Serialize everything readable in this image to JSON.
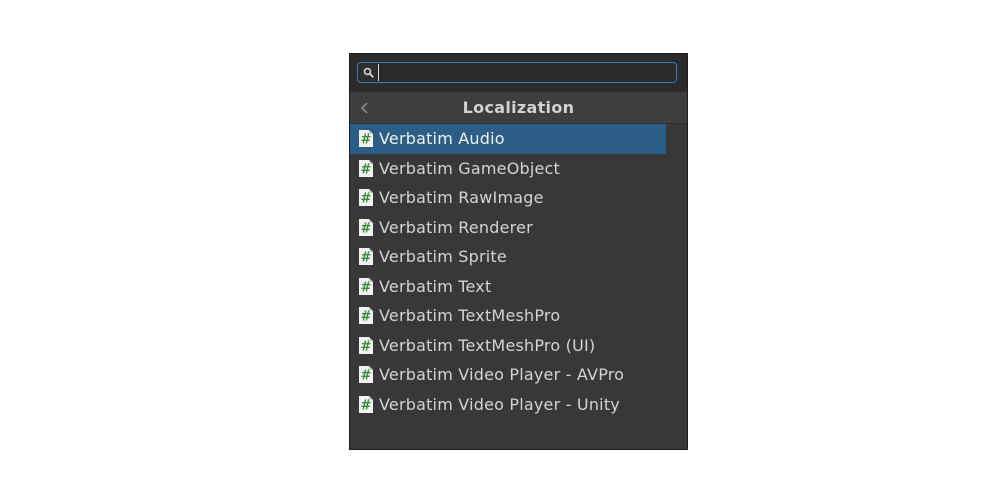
{
  "search": {
    "value": "",
    "placeholder": ""
  },
  "header": {
    "title": "Localization",
    "back_icon": "chevron-left-icon"
  },
  "items": [
    {
      "label": "Verbatim Audio",
      "icon": "script-hash-icon",
      "selected": true
    },
    {
      "label": "Verbatim GameObject",
      "icon": "script-hash-icon",
      "selected": false
    },
    {
      "label": "Verbatim RawImage",
      "icon": "script-hash-icon",
      "selected": false
    },
    {
      "label": "Verbatim Renderer",
      "icon": "script-hash-icon",
      "selected": false
    },
    {
      "label": "Verbatim Sprite",
      "icon": "script-hash-icon",
      "selected": false
    },
    {
      "label": "Verbatim Text",
      "icon": "script-hash-icon",
      "selected": false
    },
    {
      "label": "Verbatim TextMeshPro",
      "icon": "script-hash-icon",
      "selected": false
    },
    {
      "label": "Verbatim TextMeshPro (UI)",
      "icon": "script-hash-icon",
      "selected": false
    },
    {
      "label": "Verbatim Video Player - AVPro",
      "icon": "script-hash-icon",
      "selected": false
    },
    {
      "label": "Verbatim Video Player - Unity",
      "icon": "script-hash-icon",
      "selected": false
    }
  ],
  "colors": {
    "panel_bg": "#383838",
    "selection": "#2c5d87",
    "search_focus_border": "#3a79bb",
    "icon_hash": "#3a8a3a"
  }
}
